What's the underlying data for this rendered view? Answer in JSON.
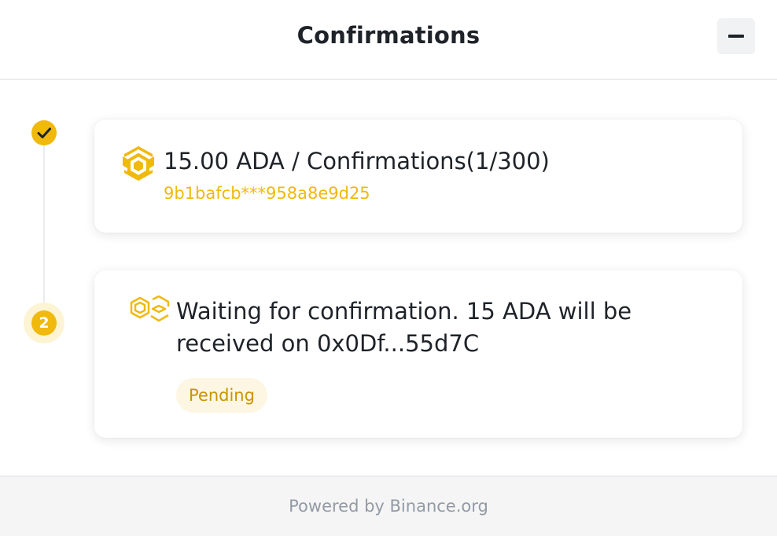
{
  "header": {
    "title": "Confirmations",
    "minimize_icon": "minus-icon"
  },
  "steps": [
    {
      "status": "completed",
      "icon": "check-icon",
      "amount_line": "15.00 ADA / Confirmations(1/300)",
      "tx_hash": "9b1bafcb***958a8e9d25",
      "logo_icon": "binance-logo-icon"
    },
    {
      "status": "pending",
      "step_number": "2",
      "message": "Waiting for confirmation. 15 ADA will be received on 0x0Df...55d7C",
      "badge": "Pending",
      "logo_icon": "binance-logo-outline-icon"
    }
  ],
  "footer": {
    "powered_by": "Powered by Binance.org"
  },
  "colors": {
    "accent": "#f0b90b",
    "badge_bg": "#fdf6e3",
    "badge_text": "#c99400",
    "muted_text": "#929aa5"
  }
}
